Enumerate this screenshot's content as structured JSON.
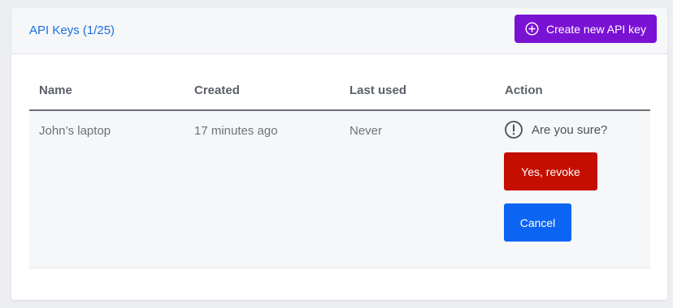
{
  "header": {
    "title": "API Keys (1/25)",
    "create_button_label": "Create new API key",
    "create_icon": "plus-circle-icon"
  },
  "table": {
    "columns": [
      "Name",
      "Created",
      "Last used",
      "Action"
    ],
    "rows": [
      {
        "name": "John’s laptop",
        "created": "17 minutes ago",
        "last_used": "Never",
        "action": {
          "confirm_text": "Are you sure?",
          "confirm_icon": "exclamation-circle-icon",
          "revoke_label": "Yes, revoke",
          "cancel_label": "Cancel"
        }
      }
    ]
  },
  "colors": {
    "title": "#1a6fe0",
    "create_button": "#7a12d4",
    "revoke_button": "#c40f00",
    "cancel_button": "#0b64f2"
  }
}
